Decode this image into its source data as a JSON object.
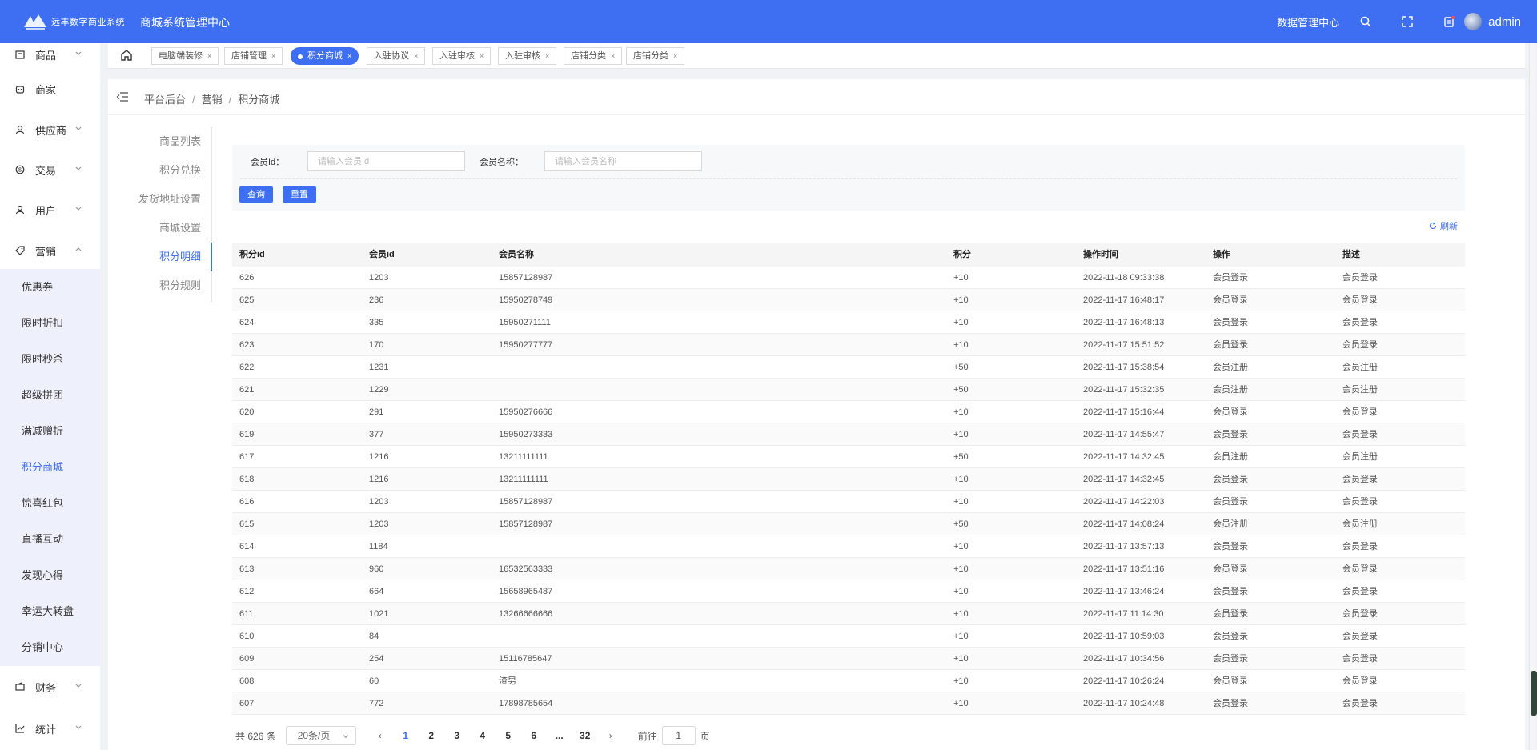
{
  "header": {
    "logo_text": "远丰数字商业系统",
    "system_title": "商城系统管理中心",
    "data_center": "数据管理中心",
    "user_name": "admin"
  },
  "sidebar": {
    "items": [
      {
        "label": "商品",
        "icon": "package-icon"
      },
      {
        "label": "商家",
        "icon": "store-icon"
      },
      {
        "label": "供应商",
        "icon": "supplier-icon"
      },
      {
        "label": "交易",
        "icon": "transaction-icon"
      },
      {
        "label": "用户",
        "icon": "user-icon"
      },
      {
        "label": "营销",
        "icon": "tag-icon"
      },
      {
        "label": "财务",
        "icon": "wallet-icon"
      },
      {
        "label": "统计",
        "icon": "chart-icon"
      }
    ],
    "submenu": [
      "优惠券",
      "限时折扣",
      "限时秒杀",
      "超级拼团",
      "满减赠折",
      "积分商城",
      "惊喜红包",
      "直播互动",
      "发现心得",
      "幸运大转盘",
      "分销中心"
    ],
    "active_sub": "积分商城"
  },
  "tabs": [
    {
      "label": "电脑端装修",
      "active": false
    },
    {
      "label": "店铺管理",
      "active": false
    },
    {
      "label": "积分商城",
      "active": true
    },
    {
      "label": "入驻协议",
      "active": false
    },
    {
      "label": "入驻审核",
      "active": false
    },
    {
      "label": "入驻审核",
      "active": false
    },
    {
      "label": "店铺分类",
      "active": false
    },
    {
      "label": "店铺分类",
      "active": false
    }
  ],
  "breadcrumb": [
    "平台后台",
    "营销",
    "积分商城"
  ],
  "sidenav": {
    "items": [
      "商品列表",
      "积分兑换",
      "发货地址设置",
      "商城设置",
      "积分明细",
      "积分规则"
    ],
    "active": "积分明细"
  },
  "search": {
    "member_id_label": "会员Id：",
    "member_id_placeholder": "请输入会员Id",
    "member_name_label": "会员名称：",
    "member_name_placeholder": "请输入会员名称",
    "query_btn": "查询",
    "reset_btn": "重置"
  },
  "refresh_label": "刷新",
  "table": {
    "columns": [
      "积分id",
      "会员id",
      "会员名称",
      "积分",
      "操作时间",
      "操作",
      "描述"
    ],
    "rows": [
      [
        "626",
        "1203",
        "15857128987",
        "+10",
        "2022-11-18 09:33:38",
        "会员登录",
        "会员登录"
      ],
      [
        "625",
        "236",
        "15950278749",
        "+10",
        "2022-11-17 16:48:17",
        "会员登录",
        "会员登录"
      ],
      [
        "624",
        "335",
        "15950271111",
        "+10",
        "2022-11-17 16:48:13",
        "会员登录",
        "会员登录"
      ],
      [
        "623",
        "170",
        "15950277777",
        "+10",
        "2022-11-17 15:51:52",
        "会员登录",
        "会员登录"
      ],
      [
        "622",
        "1231",
        "",
        "+50",
        "2022-11-17 15:38:54",
        "会员注册",
        "会员注册"
      ],
      [
        "621",
        "1229",
        "",
        "+50",
        "2022-11-17 15:32:35",
        "会员注册",
        "会员注册"
      ],
      [
        "620",
        "291",
        "15950276666",
        "+10",
        "2022-11-17 15:16:44",
        "会员登录",
        "会员登录"
      ],
      [
        "619",
        "377",
        "15950273333",
        "+10",
        "2022-11-17 14:55:47",
        "会员登录",
        "会员登录"
      ],
      [
        "617",
        "1216",
        "13211111111",
        "+50",
        "2022-11-17 14:32:45",
        "会员注册",
        "会员注册"
      ],
      [
        "618",
        "1216",
        "13211111111",
        "+10",
        "2022-11-17 14:32:45",
        "会员登录",
        "会员登录"
      ],
      [
        "616",
        "1203",
        "15857128987",
        "+10",
        "2022-11-17 14:22:03",
        "会员登录",
        "会员登录"
      ],
      [
        "615",
        "1203",
        "15857128987",
        "+50",
        "2022-11-17 14:08:24",
        "会员注册",
        "会员注册"
      ],
      [
        "614",
        "1184",
        "",
        "+10",
        "2022-11-17 13:57:13",
        "会员登录",
        "会员登录"
      ],
      [
        "613",
        "960",
        "16532563333",
        "+10",
        "2022-11-17 13:51:16",
        "会员登录",
        "会员登录"
      ],
      [
        "612",
        "664",
        "15658965487",
        "+10",
        "2022-11-17 13:46:24",
        "会员登录",
        "会员登录"
      ],
      [
        "611",
        "1021",
        "13266666666",
        "+10",
        "2022-11-17 11:14:30",
        "会员登录",
        "会员登录"
      ],
      [
        "610",
        "84",
        "",
        "+10",
        "2022-11-17 10:59:03",
        "会员登录",
        "会员登录"
      ],
      [
        "609",
        "254",
        "15116785647",
        "+10",
        "2022-11-17 10:34:56",
        "会员登录",
        "会员登录"
      ],
      [
        "608",
        "60",
        "渣男",
        "+10",
        "2022-11-17 10:26:24",
        "会员登录",
        "会员登录"
      ],
      [
        "607",
        "772",
        "17898785654",
        "+10",
        "2022-11-17 10:24:48",
        "会员登录",
        "会员登录"
      ]
    ]
  },
  "pagination": {
    "total": "共 626 条",
    "page_size": "20条/页",
    "pages": [
      "1",
      "2",
      "3",
      "4",
      "5",
      "6",
      "...",
      "32"
    ],
    "current": "1",
    "goto_prefix": "前往",
    "goto_value": "1",
    "goto_suffix": "页"
  },
  "colors": {
    "primary": "#3e6ff3"
  }
}
